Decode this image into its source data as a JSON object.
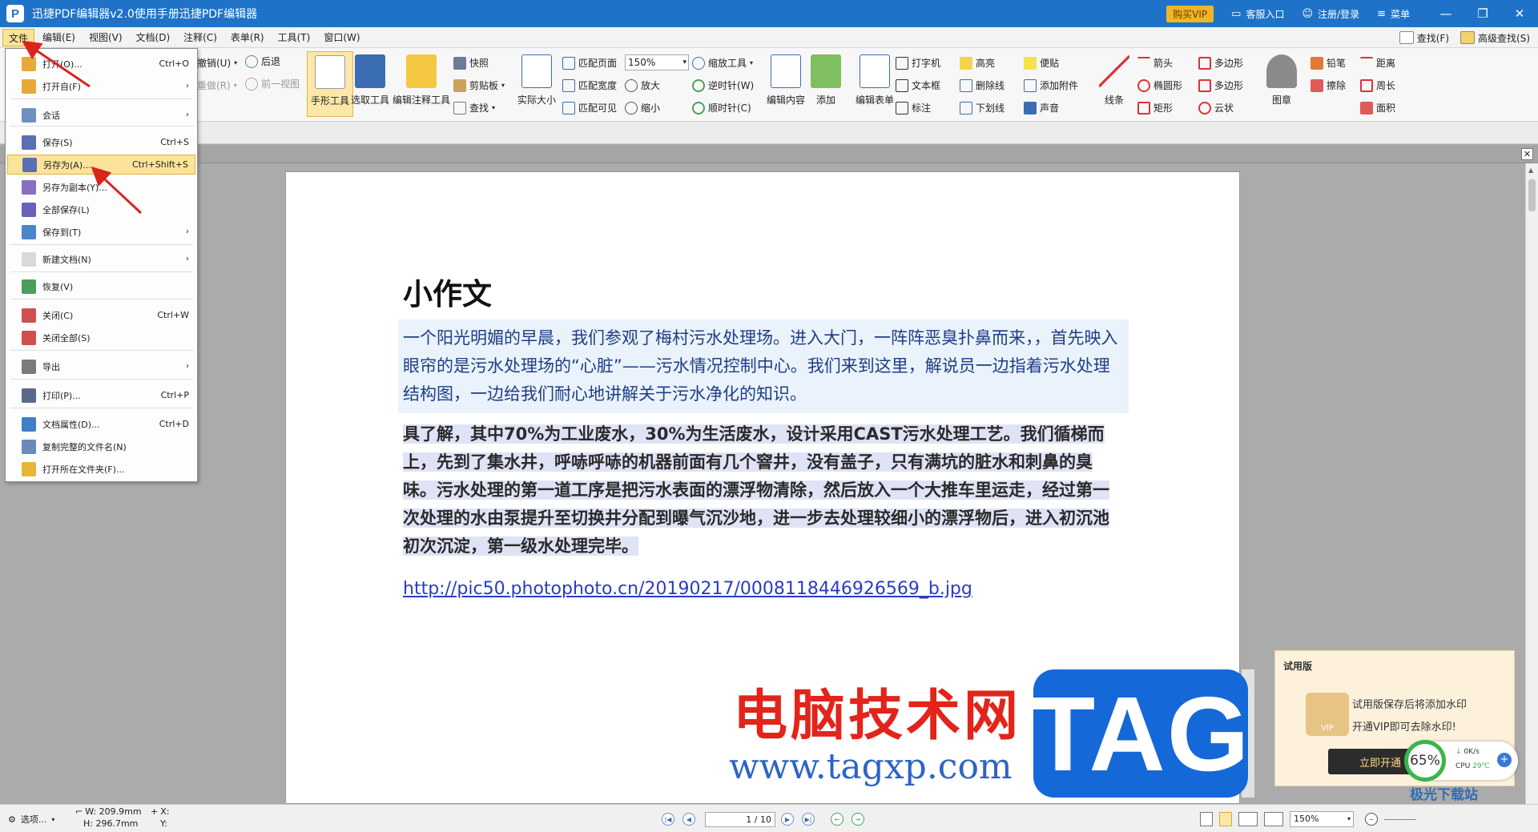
{
  "window": {
    "title": "迅捷PDF编辑器v2.0使用手册迅捷PDF编辑器",
    "vip_label": "购买VIP",
    "service_label": "客服入口",
    "login_label": "注册/登录",
    "menu_label": "菜单",
    "logo_letter": "P"
  },
  "menubar": {
    "items": [
      "文件",
      "编辑(E)",
      "视图(V)",
      "文档(D)",
      "注释(C)",
      "表单(R)",
      "工具(T)",
      "窗口(W)"
    ],
    "find_label": "查找(F)",
    "adv_find_label": "高级查找(S)"
  },
  "ribbon": {
    "undo": "撤销(U)",
    "redo": "重做(R)",
    "back": "后退",
    "forward": "前一视图",
    "hand_tool": "手形工具",
    "select_tool": "选取工具",
    "edit_annot": "编辑注释工具",
    "snapshot": "快照",
    "clipboard": "剪贴板",
    "find": "查找",
    "actual_size": "实际大小",
    "fit_page": "匹配页面",
    "fit_width": "匹配宽度",
    "fit_visible": "匹配可见",
    "zoom_value": "150%",
    "zoom_tool": "缩放工具",
    "zoom_in": "放大",
    "zoom_out": "缩小",
    "rotate_ccw": "逆时针(W)",
    "rotate_cw": "顺时针(C)",
    "edit_content": "编辑内容",
    "add": "添加",
    "edit_form": "编辑表单",
    "typewriter": "打字机",
    "textbox": "文本框",
    "callout": "标注",
    "highlight": "高亮",
    "strikeout": "删除线",
    "underline": "下划线",
    "note": "便贴",
    "attach": "添加附件",
    "sound": "声音",
    "line": "线条",
    "arrow": "箭头",
    "ellipse": "椭圆形",
    "rect": "矩形",
    "polygon": "多边形",
    "polyline": "多边形",
    "cloud": "云状",
    "stamp": "图章",
    "pencil": "铅笔",
    "eraser": "擦除",
    "distance": "距离",
    "perimeter": "周长",
    "area": "面积"
  },
  "file_menu": {
    "items": [
      {
        "label": "打开(O)...",
        "shortcut": "Ctrl+O",
        "arrow": "›",
        "color": "#e8a93a"
      },
      {
        "label": "打开自(F)",
        "shortcut": "",
        "arrow": "›",
        "color": "#e8a93a"
      },
      {
        "label": "会话",
        "shortcut": "",
        "arrow": "›",
        "color": "#6f8fc0"
      },
      {
        "label": "保存(S)",
        "shortcut": "Ctrl+S",
        "arrow": "",
        "color": "#5b6fb4"
      },
      {
        "label": "另存为(A)...",
        "shortcut": "Ctrl+Shift+S",
        "arrow": "",
        "color": "#5b6fb4"
      },
      {
        "label": "另存为副本(Y)...",
        "shortcut": "",
        "arrow": "",
        "color": "#8a6fc0"
      },
      {
        "label": "全部保存(L)",
        "shortcut": "",
        "arrow": "",
        "color": "#6a62b8"
      },
      {
        "label": "保存到(T)",
        "shortcut": "",
        "arrow": "›",
        "color": "#4a86c8"
      },
      {
        "label": "新建文档(N)",
        "shortcut": "",
        "arrow": "›",
        "color": "#d9d9d9"
      },
      {
        "label": "恢复(V)",
        "shortcut": "",
        "arrow": "",
        "color": "#4aa05a"
      },
      {
        "label": "关闭(C)",
        "shortcut": "Ctrl+W",
        "arrow": "",
        "color": "#d05050"
      },
      {
        "label": "关闭全部(S)",
        "shortcut": "",
        "arrow": "",
        "color": "#d05050"
      },
      {
        "label": "导出",
        "shortcut": "",
        "arrow": "›",
        "color": "#7a7a7a"
      },
      {
        "label": "打印(P)...",
        "shortcut": "Ctrl+P",
        "arrow": "",
        "color": "#5a6a8a"
      },
      {
        "label": "文档属性(D)...",
        "shortcut": "Ctrl+D",
        "arrow": "",
        "color": "#3f7fc8"
      },
      {
        "label": "复制完整的文件名(N)",
        "shortcut": "",
        "arrow": "",
        "color": "#6a8ab8"
      },
      {
        "label": "打开所在文件夹(F)...",
        "shortcut": "",
        "arrow": "",
        "color": "#e8b43a"
      }
    ]
  },
  "document": {
    "title": "小作文",
    "para1": "一个阳光明媚的早晨，我们参观了梅村污水处理场。进入大门，一阵阵恶臭扑鼻而来，，首先映入眼帘的是污水处理场的“心脏”——污水情况控制中心。我们来到这里，解说员一边指着污水处理结构图，一边给我们耐心地讲解关于污水净化的知识。",
    "para2": "具了解，其中70%为工业废水，30%为生活废水，设计采用CAST污水处理工艺。我们循梯而上，先到了集水井，呼哧呼哧的机器前面有几个窨井，没有盖子，只有满坑的脏水和刺鼻的臭味。污水处理的第一道工序是把污水表面的漂浮物清除，然后放入一个大推车里运走，经过第一次处理的水由泵提升至切换井分配到曝气沉沙地，进一步去处理较细小的漂浮物后，进入初沉池初次沉淀，第一级水处理完毕。",
    "link": "http://pic50.photophoto.cn/20190217/0008118446926569_b.jpg"
  },
  "watermark": {
    "cn": "电脑技术网",
    "url": "www.tagxp.com",
    "tag": "TAG",
    "site": "极光下载站"
  },
  "trial": {
    "title": "试用版",
    "line1": "试用版保存后将添加水印",
    "line2": "开通VIP即可去除水印!",
    "button": "立即开通",
    "badge": "VIP"
  },
  "perf": {
    "percent": "65%",
    "net": "0K/s",
    "cpu_label": "CPU",
    "cpu_temp": "29℃"
  },
  "statusbar": {
    "select_label": "选项...",
    "width": "W: 209.9mm",
    "height": "H: 296.7mm",
    "x_label": "X:",
    "y_label": "Y:",
    "page": "1 / 10",
    "zoom": "150%"
  }
}
